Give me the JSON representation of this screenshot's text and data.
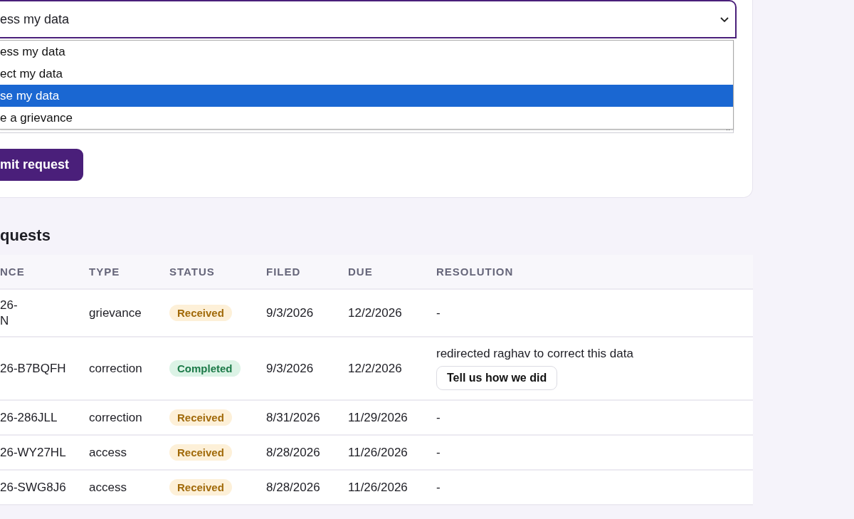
{
  "request_form": {
    "request_type": {
      "value": "ess my data",
      "expanded": true,
      "options": [
        {
          "label": "ess my data",
          "highlighted": false
        },
        {
          "label": "ect my data",
          "highlighted": false
        },
        {
          "label": "se my data",
          "highlighted": true
        },
        {
          "label": "e a grievance",
          "highlighted": false
        }
      ]
    },
    "submit_button": "mit request"
  },
  "requests": {
    "heading": "quests",
    "columns": [
      "NCE",
      "TYPE",
      "STATUS",
      "FILED",
      "DUE",
      "RESOLUTION"
    ],
    "rows": [
      {
        "reference": "26-\nN",
        "type": "grievance",
        "status": {
          "label": "Received",
          "kind": "received"
        },
        "filed": "9/3/2026",
        "due": "12/2/2026",
        "resolution": "-"
      },
      {
        "reference": "26-B7BQFH",
        "type": "correction",
        "status": {
          "label": "Completed",
          "kind": "completed"
        },
        "filed": "9/3/2026",
        "due": "12/2/2026",
        "resolution": "redirected raghav to correct this data",
        "feedback_button": "Tell us how we did"
      },
      {
        "reference": "26-286JLL",
        "type": "correction",
        "status": {
          "label": "Received",
          "kind": "received"
        },
        "filed": "8/31/2026",
        "due": "11/29/2026",
        "resolution": "-"
      },
      {
        "reference": "26-WY27HL",
        "type": "access",
        "status": {
          "label": "Received",
          "kind": "received"
        },
        "filed": "8/28/2026",
        "due": "11/26/2026",
        "resolution": "-"
      },
      {
        "reference": "26-SWG8J6",
        "type": "access",
        "status": {
          "label": "Received",
          "kind": "received"
        },
        "filed": "8/28/2026",
        "due": "11/26/2026",
        "resolution": "-"
      }
    ]
  }
}
